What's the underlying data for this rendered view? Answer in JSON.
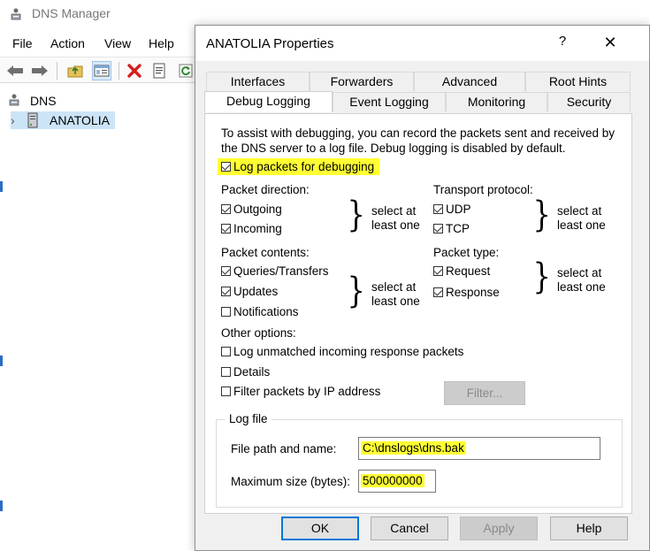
{
  "mmc": {
    "title": "DNS Manager",
    "menu": [
      "File",
      "Action",
      "View",
      "Help"
    ],
    "tree": {
      "root_label": "DNS",
      "expander": "›",
      "server_label": "ANATOLIA"
    }
  },
  "dialog": {
    "title": "ANATOLIA Properties",
    "help_glyph": "?",
    "close_glyph": "✕",
    "tabs_row1": [
      "Interfaces",
      "Forwarders",
      "Advanced",
      "Root Hints"
    ],
    "tabs_row2": [
      "Debug Logging",
      "Event Logging",
      "Monitoring",
      "Security"
    ],
    "active_tab": "Debug Logging",
    "intro_line1": "To assist with debugging, you can record the packets sent and received by",
    "intro_line2": "the DNS server to a log file. Debug logging is disabled by default.",
    "log_packets": {
      "label": "Log packets for debugging",
      "checked": true
    },
    "packet_direction": {
      "heading": "Packet direction:",
      "outgoing": {
        "label": "Outgoing",
        "checked": true
      },
      "incoming": {
        "label": "Incoming",
        "checked": true
      },
      "note_line1": "select at",
      "note_line2": "least one"
    },
    "transport_protocol": {
      "heading": "Transport protocol:",
      "udp": {
        "label": "UDP",
        "checked": true
      },
      "tcp": {
        "label": "TCP",
        "checked": true
      },
      "note_line1": "select at",
      "note_line2": "least one"
    },
    "packet_contents": {
      "heading": "Packet contents:",
      "queries": {
        "label": "Queries/Transfers",
        "checked": true
      },
      "updates": {
        "label": "Updates",
        "checked": true
      },
      "notifications": {
        "label": "Notifications",
        "checked": false
      },
      "note_line1": "select at",
      "note_line2": "least one"
    },
    "packet_type": {
      "heading": "Packet type:",
      "request": {
        "label": "Request",
        "checked": true
      },
      "response": {
        "label": "Response",
        "checked": true
      },
      "note_line1": "select at",
      "note_line2": "least one"
    },
    "other_options": {
      "heading": "Other options:",
      "log_unmatched": {
        "label": "Log unmatched incoming response packets",
        "checked": false
      },
      "details": {
        "label": "Details",
        "checked": false
      },
      "filter_by_ip": {
        "label": "Filter packets by IP address",
        "checked": false
      },
      "filter_button": "Filter..."
    },
    "log_file": {
      "legend": "Log file",
      "path_label": "File path and name:",
      "path_value": "C:\\dnslogs\\dns.bak",
      "size_label": "Maximum size (bytes):",
      "size_value": "500000000"
    },
    "buttons": {
      "ok": "OK",
      "cancel": "Cancel",
      "apply": "Apply",
      "help": "Help"
    }
  },
  "colors": {
    "highlight": "#ffff33",
    "selection": "#cce4f7",
    "focus": "#0078d7"
  }
}
